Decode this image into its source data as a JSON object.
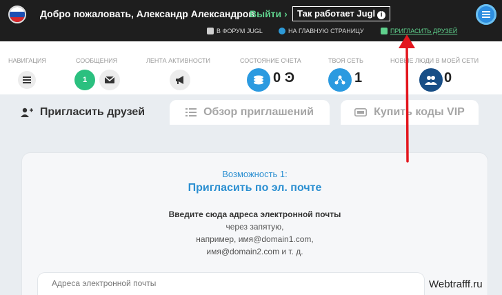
{
  "header": {
    "welcome_text": "Добро пожаловать, Александр Александров",
    "logout_label": "Выйти",
    "how_it_works_label": "Так работает Jugl",
    "forum_link": "В ФОРУМ JUGL",
    "home_link": "НА ГЛАВНУЮ СТРАНИЦУ",
    "invite_link": "ПРИГЛАСИТЬ ДРУЗЕЙ"
  },
  "stats": {
    "navigation_label": "НАВИГАЦИЯ",
    "messages_label": "СООБЩЕНИЯ",
    "messages_count": "1",
    "activity_label": "ЛЕНТА АКТИВНОСТИ",
    "balance_label": "СОСТОЯНИЕ СЧЕТА",
    "balance_value": "0 Ͽ",
    "network_label": "ТВОЯ СЕТЬ",
    "network_value": "1",
    "new_people_label": "НОВЫЕ ЛЮДИ В МОЕЙ СЕТИ",
    "new_people_value": "0"
  },
  "tabs": [
    {
      "label": "Пригласить друзей"
    },
    {
      "label": "Обзор приглашений"
    },
    {
      "label": "Купить коды VIP"
    }
  ],
  "content": {
    "opportunity": "Возможность 1:",
    "invite_title": "Пригласить по эл. почте",
    "instruction_title": "Введите сюда адреса электронной почты",
    "instruction_line1": "через запятую,",
    "instruction_line2": "например, имя@domain1.com,",
    "instruction_line3": "имя@domain2.com и т. д.",
    "email_label": "Адреса электронной почты"
  },
  "watermark": "Webtrafff.ru",
  "colors": {
    "header_bg": "#1e1e1e",
    "accent_green": "#5fd08c",
    "accent_blue": "#2b8fd1",
    "arrow_red": "#e3161e"
  }
}
